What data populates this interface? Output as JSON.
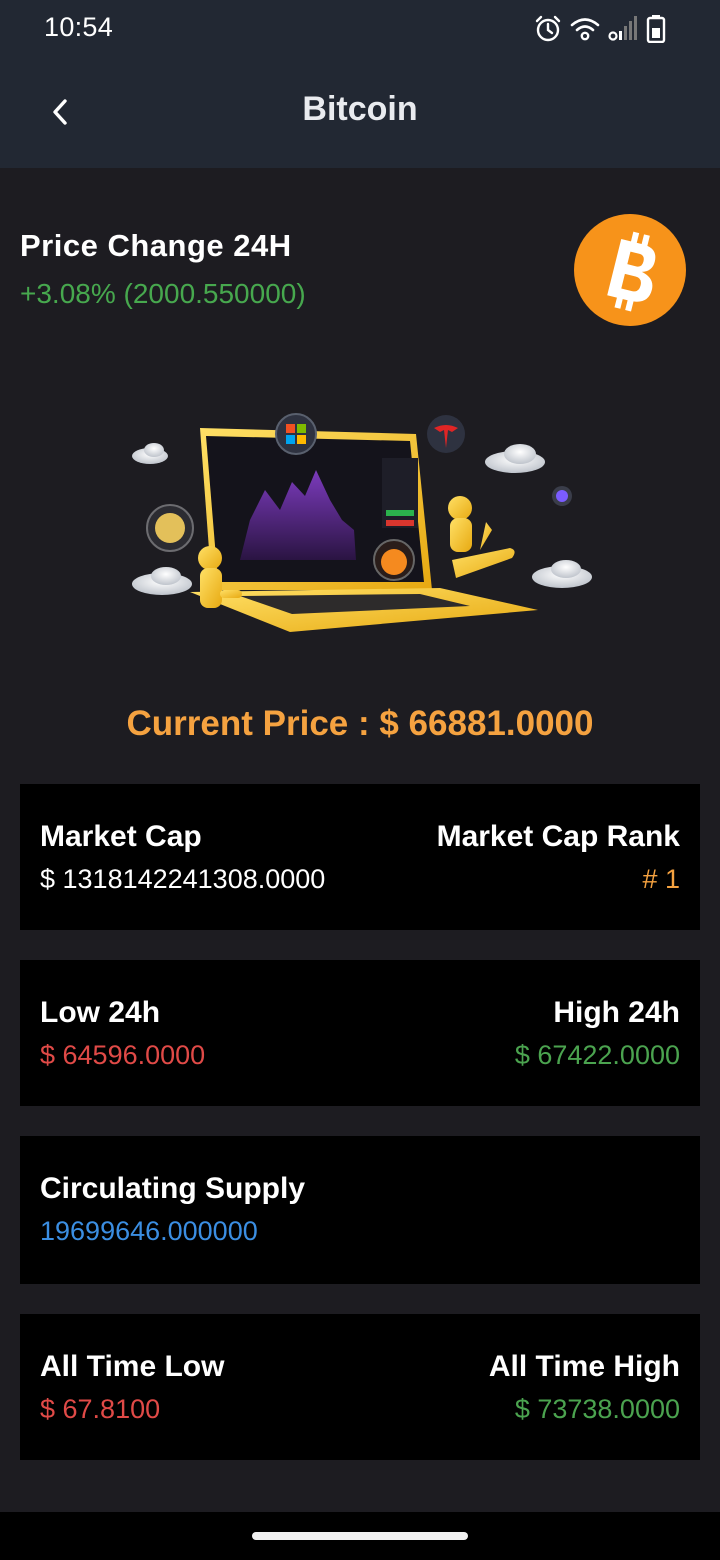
{
  "status_bar": {
    "time": "10:54",
    "icons": [
      "alarm-icon",
      "wifi-icon",
      "signal-icon",
      "battery-icon"
    ]
  },
  "app_bar": {
    "title": "Bitcoin",
    "back_icon": "chevron-left-icon"
  },
  "price_change": {
    "label": "Price Change 24H",
    "value": "+3.08% (2000.550000)",
    "color": "#47a84e"
  },
  "coin_logo": {
    "icon": "bitcoin-logo",
    "color": "#f7931a"
  },
  "hero_image": {
    "description_icon": "trading-laptop-illustration"
  },
  "current_price": {
    "text": "Current Price : $ 66881.0000",
    "color": "#f5a240"
  },
  "cards": {
    "market": {
      "left_label": "Market Cap",
      "left_value": "$ 1318142241308.0000",
      "right_label": "Market Cap Rank",
      "right_value": "# 1"
    },
    "range24": {
      "left_label": "Low 24h",
      "left_value": "$ 64596.0000",
      "right_label": "High 24h",
      "right_value": "$ 67422.0000"
    },
    "supply": {
      "left_label": "Circulating Supply",
      "left_value": "19699646.000000"
    },
    "alltime": {
      "left_label": "All Time Low",
      "left_value": "$ 67.8100",
      "right_label": "All Time High",
      "right_value": "$ 73738.0000"
    }
  },
  "colors": {
    "background": "#1d1c21",
    "bar": "#222833",
    "card": "#000000",
    "negative": "#e04a47",
    "positive": "#4ba34f",
    "accent": "#f5a240",
    "info": "#3b8ee2"
  }
}
